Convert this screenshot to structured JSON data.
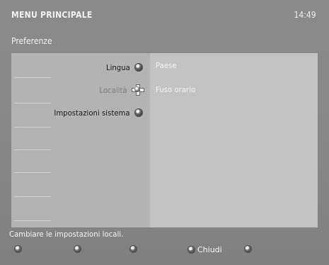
{
  "header": {
    "title": "MENU PRINCIPALE",
    "time": "14:49"
  },
  "subtitle": "Preferenze",
  "menu": {
    "items": [
      {
        "label": "Lingua",
        "icon": "knob-icon",
        "dim": false
      },
      {
        "label": "Località",
        "icon": "dpad-icon",
        "dim": true
      },
      {
        "label": "Impostazioni sistema",
        "icon": "knob-icon",
        "dim": false
      }
    ]
  },
  "submenu": {
    "items": [
      "Paese",
      "Fuso orario"
    ]
  },
  "status_text": "Cambiare le impostazioni locali.",
  "footer": {
    "buttons": [
      {
        "label": "",
        "icon": "color-button-icon"
      },
      {
        "label": "",
        "icon": "color-button-icon"
      },
      {
        "label": "",
        "icon": "color-button-icon"
      },
      {
        "label": "Chiudi",
        "icon": "color-button-icon"
      },
      {
        "label": "",
        "icon": "color-button-icon"
      }
    ]
  }
}
